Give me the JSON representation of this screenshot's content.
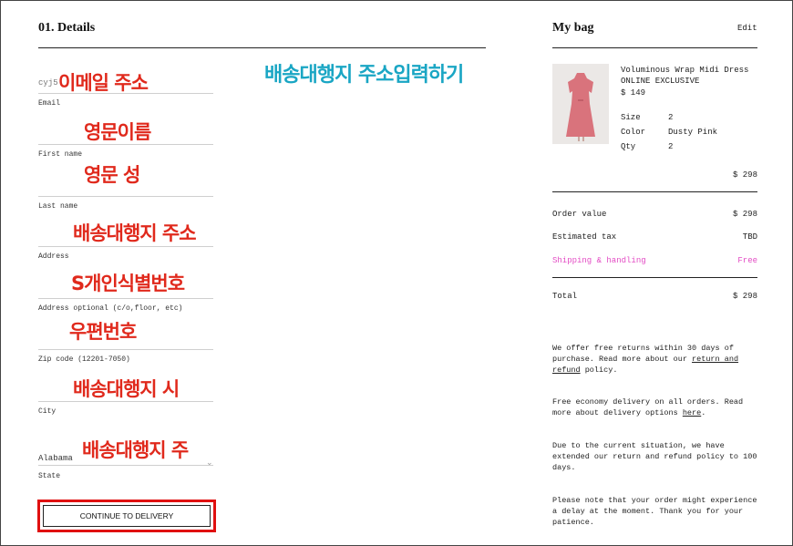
{
  "checkout": {
    "section_title": "01. Details",
    "fields": {
      "email": {
        "value": "cyj5",
        "label": "Email"
      },
      "first_name": {
        "label": "First name"
      },
      "last_name": {
        "label": "Last name"
      },
      "address": {
        "label": "Address"
      },
      "address_optional": {
        "label": "Address optional (c/o,floor, etc)"
      },
      "zip": {
        "label": "Zip code (12201-7050)"
      },
      "city": {
        "label": "City"
      },
      "state": {
        "value": "Alabama",
        "label": "State"
      }
    },
    "continue_label": "CONTINUE TO DELIVERY"
  },
  "annotations": {
    "title": "배송대행지 주소입력하기",
    "email": "이메일 주소",
    "first_name": "영문이름",
    "last_name": "영문 성",
    "address": "배송대행지 주소",
    "address_optional": "S개인식별번호",
    "zip": "우편번호",
    "city": "배송대행지 시",
    "state": "배송대행지 주"
  },
  "bag": {
    "title": "My bag",
    "edit_label": "Edit",
    "product": {
      "name": "Voluminous Wrap Midi Dress",
      "tag": "ONLINE EXCLUSIVE",
      "price": "$ 149",
      "size_label": "Size",
      "size_value": "2",
      "color_label": "Color",
      "color_value": "Dusty Pink",
      "qty_label": "Qty",
      "qty_value": "2",
      "line_total": "$ 298"
    },
    "summary": {
      "order_value_label": "Order value",
      "order_value": "$ 298",
      "tax_label": "Estimated tax",
      "tax_value": "TBD",
      "shipping_label": "Shipping & handling",
      "shipping_value": "Free",
      "total_label": "Total",
      "total_value": "$ 298"
    },
    "notes": {
      "returns_pre": "We offer free returns within 30 days of purchase. Read more about our ",
      "returns_link": "return and refund",
      "returns_post": " policy.",
      "delivery_pre": "Free economy delivery on all orders. Read more about delivery options ",
      "delivery_link": "here",
      "delivery_post": ".",
      "situation": "Due to the current situation, we have extended our return and refund policy to 100 days.",
      "delay": "Please note that your order might experience a delay at the moment. Thank you for your patience."
    }
  },
  "colors": {
    "annotation_red": "#e0291c",
    "annotation_blue": "#1aa6c4",
    "shipping_pink": "#e34bc4",
    "highlight_border": "#e01010"
  }
}
